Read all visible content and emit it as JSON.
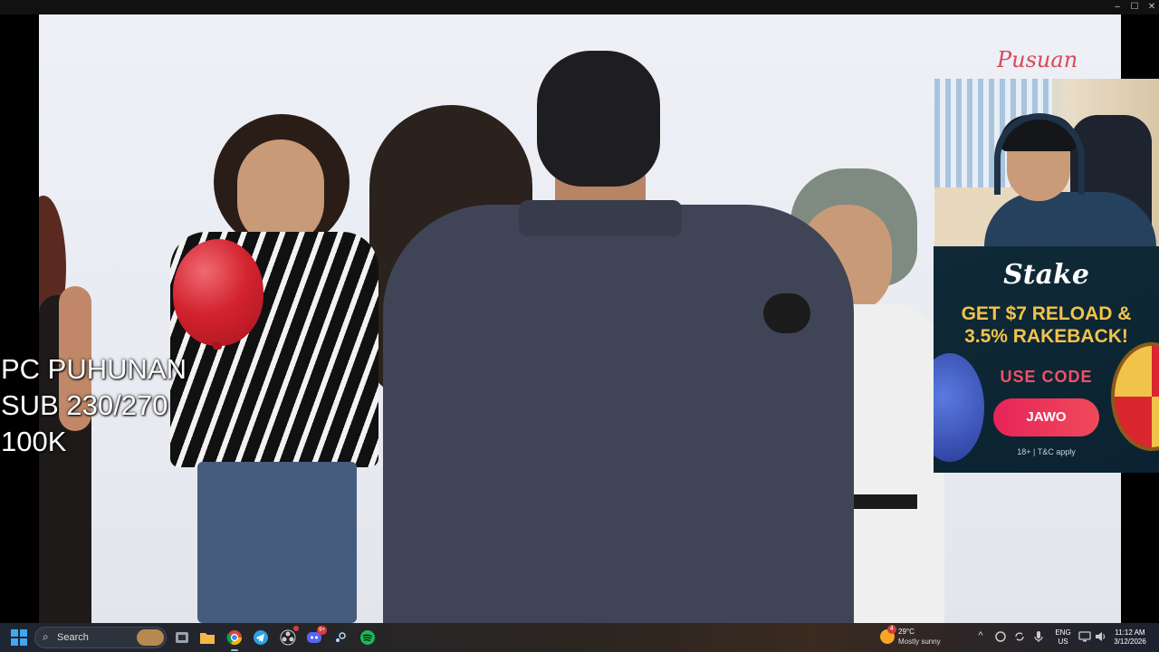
{
  "window": {
    "controls": {
      "minimize": "–",
      "maximize": "☐",
      "close": "✕"
    }
  },
  "video": {
    "corner_logo": "Pusuan",
    "overlay_lines": [
      "PC PUHUNAN",
      "SUB 230/270",
      "100K"
    ]
  },
  "ad": {
    "brand": "Stake",
    "headline_line1": "GET $7 RELOAD &",
    "headline_line2": "3.5% RAKEBACK!",
    "use_code_label": "USE CODE",
    "code": "JAWO",
    "terms": "18+ | T&C apply",
    "colors": {
      "headline": "#f2c34a",
      "use_code": "#f0506a",
      "button": "#e8235a"
    }
  },
  "taskbar": {
    "search_placeholder": "Search",
    "apps": [
      {
        "name": "task-view",
        "icon": "task-view-icon"
      },
      {
        "name": "file-explorer",
        "icon": "folder-icon"
      },
      {
        "name": "chrome",
        "icon": "chrome-icon",
        "active": true
      },
      {
        "name": "telegram",
        "icon": "telegram-icon"
      },
      {
        "name": "obs",
        "icon": "obs-icon"
      },
      {
        "name": "discord",
        "icon": "discord-icon",
        "badge": "9+"
      },
      {
        "name": "steam",
        "icon": "steam-icon"
      },
      {
        "name": "spotify",
        "icon": "spotify-icon"
      }
    ],
    "weather": {
      "badge": "4",
      "temp": "29°C",
      "desc": "Mostly sunny"
    },
    "tray": {
      "overflow": "^",
      "lang_line1": "ENG",
      "lang_line2": "US"
    },
    "clock": {
      "time": "11:12 AM",
      "date": "3/12/2026"
    }
  }
}
